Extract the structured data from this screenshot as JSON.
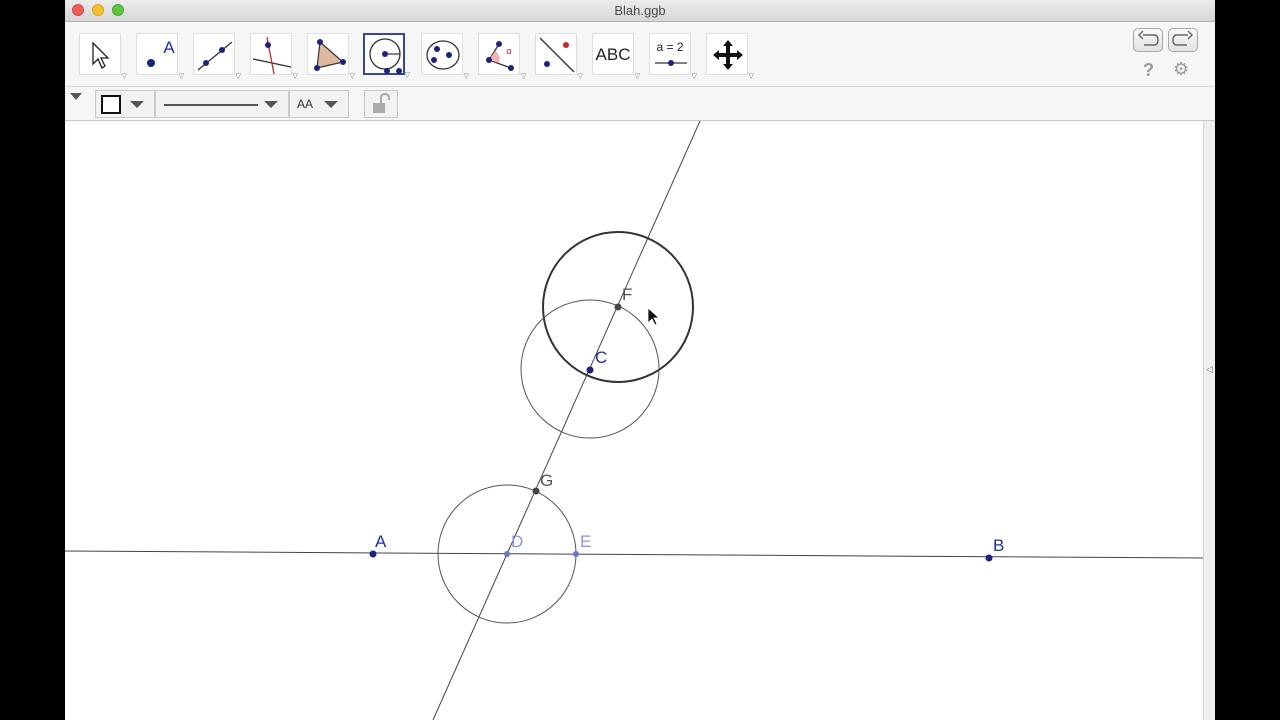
{
  "window": {
    "title": "Blah.ggb"
  },
  "toolbar": {
    "tools": [
      {
        "name": "move-tool",
        "label": ""
      },
      {
        "name": "point-tool",
        "label": "A"
      },
      {
        "name": "line-tool",
        "label": ""
      },
      {
        "name": "perpendicular-line-tool",
        "label": ""
      },
      {
        "name": "polygon-tool",
        "label": ""
      },
      {
        "name": "circle-center-point-tool",
        "label": ""
      },
      {
        "name": "conic-tool",
        "label": ""
      },
      {
        "name": "angle-tool",
        "label": "α"
      },
      {
        "name": "reflect-tool",
        "label": ""
      },
      {
        "name": "text-tool",
        "label": "ABC"
      },
      {
        "name": "slider-tool",
        "label": "a = 2"
      },
      {
        "name": "move-graphics-view-tool",
        "label": ""
      }
    ],
    "selected_tool": "circle-center-point-tool",
    "help": "?",
    "settings_icon": "gear-icon"
  },
  "stylebar": {
    "text_size_label": "AA"
  },
  "canvas": {
    "points": [
      {
        "label": "A",
        "color": "#1a237e",
        "label_color": "#1a2fa8"
      },
      {
        "label": "B",
        "color": "#1a237e",
        "label_color": "#1a2fa8"
      },
      {
        "label": "C",
        "color": "#1a237e",
        "label_color": "#1a2fa8"
      },
      {
        "label": "D",
        "color": "#6677cc",
        "label_color": "#8a96d8"
      },
      {
        "label": "E",
        "color": "#6677cc",
        "label_color": "#8a96d8"
      },
      {
        "label": "F",
        "color": "#444444",
        "label_color": "#555555"
      },
      {
        "label": "G",
        "color": "#444444",
        "label_color": "#555555"
      }
    ]
  }
}
